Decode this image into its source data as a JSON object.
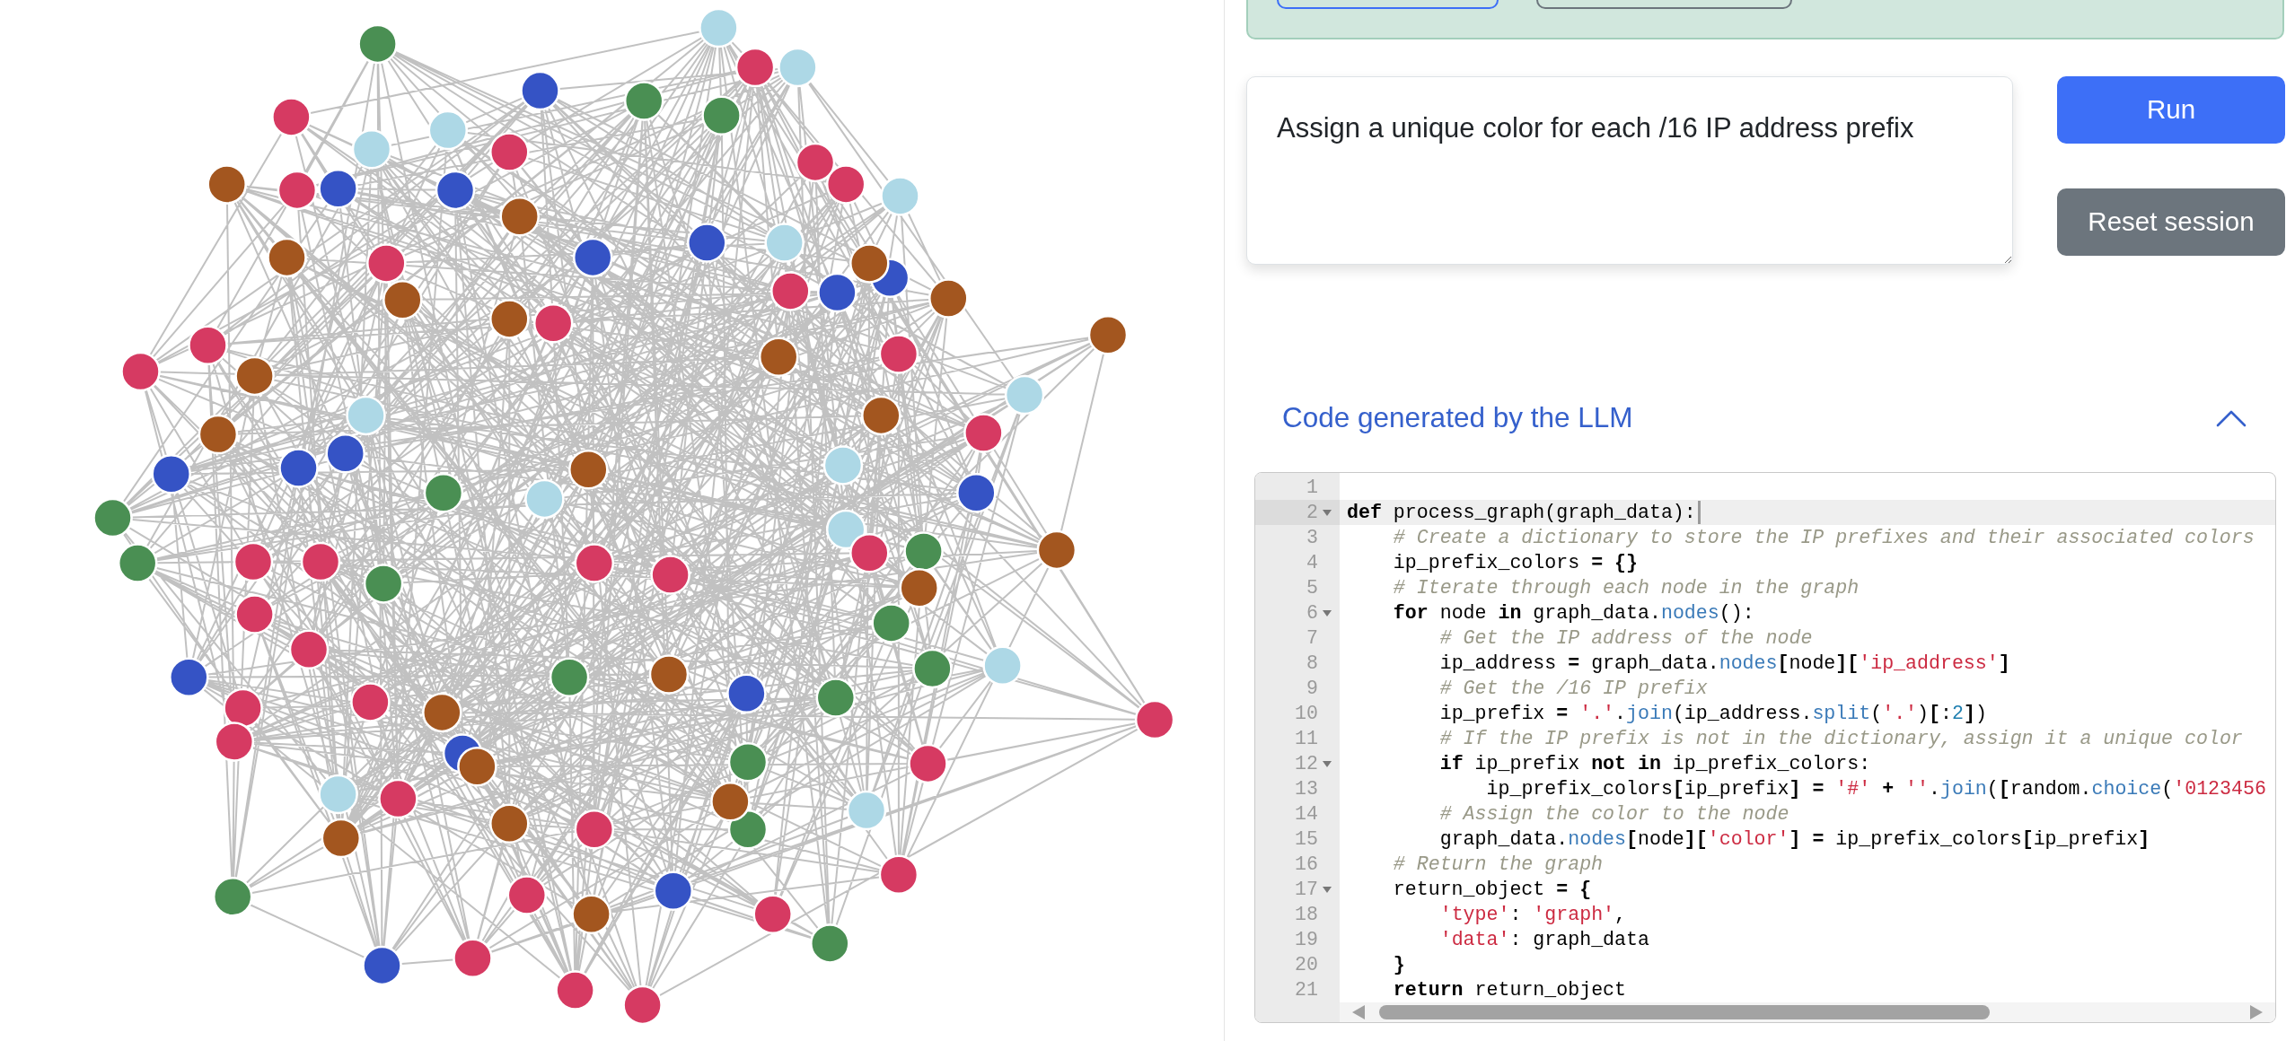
{
  "graph": {
    "nodes": [
      {
        "color": "#4a8f53"
      },
      {
        "color": "#add8e6"
      },
      {
        "color": "#d63a62"
      },
      {
        "color": "#add8e6"
      },
      {
        "color": "#3553c5"
      },
      {
        "color": "#4a8f53"
      },
      {
        "color": "#4a8f53"
      },
      {
        "color": "#d63a62"
      },
      {
        "color": "#add8e6"
      },
      {
        "color": "#add8e6"
      },
      {
        "color": "#d63a62"
      },
      {
        "color": "#d63a62"
      },
      {
        "color": "#d63a62"
      },
      {
        "color": "#add8e6"
      },
      {
        "color": "#a3561f"
      },
      {
        "color": "#d63a62"
      },
      {
        "color": "#3553c5"
      },
      {
        "color": "#3553c5"
      },
      {
        "color": "#a3561f"
      },
      {
        "color": "#add8e6"
      },
      {
        "color": "#3553c5"
      },
      {
        "color": "#3553c5"
      },
      {
        "color": "#a3561f"
      },
      {
        "color": "#d63a62"
      },
      {
        "color": "#3553c5"
      },
      {
        "color": "#a3561f"
      },
      {
        "color": "#3553c5"
      },
      {
        "color": "#d63a62"
      },
      {
        "color": "#a3561f"
      },
      {
        "color": "#a3561f"
      },
      {
        "color": "#a3561f"
      },
      {
        "color": "#d63a62"
      },
      {
        "color": "#a3561f"
      },
      {
        "color": "#d63a62"
      },
      {
        "color": "#a3561f"
      },
      {
        "color": "#d63a62"
      },
      {
        "color": "#d63a62"
      },
      {
        "color": "#a3561f"
      },
      {
        "color": "#add8e6"
      },
      {
        "color": "#a3561f"
      },
      {
        "color": "#add8e6"
      },
      {
        "color": "#a3561f"
      },
      {
        "color": "#d63a62"
      },
      {
        "color": "#3553c5"
      },
      {
        "color": "#3553c5"
      },
      {
        "color": "#3553c5"
      },
      {
        "color": "#add8e6"
      },
      {
        "color": "#a3561f"
      },
      {
        "color": "#4a8f53"
      },
      {
        "color": "#add8e6"
      },
      {
        "color": "#3553c5"
      },
      {
        "color": "#4a8f53"
      },
      {
        "color": "#add8e6"
      },
      {
        "color": "#4a8f53"
      },
      {
        "color": "#d63a62"
      },
      {
        "color": "#d63a62"
      },
      {
        "color": "#d63a62"
      },
      {
        "color": "#d63a62"
      },
      {
        "color": "#d63a62"
      },
      {
        "color": "#4a8f53"
      },
      {
        "color": "#a3561f"
      },
      {
        "color": "#a3561f"
      },
      {
        "color": "#4a8f53"
      },
      {
        "color": "#d63a62"
      },
      {
        "color": "#4a8f53"
      },
      {
        "color": "#d63a62"
      },
      {
        "color": "#add8e6"
      },
      {
        "color": "#4a8f53"
      },
      {
        "color": "#3553c5"
      },
      {
        "color": "#4a8f53"
      },
      {
        "color": "#a3561f"
      },
      {
        "color": "#3553c5"
      },
      {
        "color": "#4a8f53"
      },
      {
        "color": "#d63a62"
      },
      {
        "color": "#d63a62"
      },
      {
        "color": "#a3561f"
      },
      {
        "color": "#d63a62"
      },
      {
        "color": "#d63a62"
      },
      {
        "color": "#3553c5"
      },
      {
        "color": "#a3561f"
      },
      {
        "color": "#4a8f53"
      },
      {
        "color": "#d63a62"
      },
      {
        "color": "#add8e6"
      },
      {
        "color": "#d63a62"
      },
      {
        "color": "#4a8f53"
      },
      {
        "color": "#a3561f"
      },
      {
        "color": "#add8e6"
      },
      {
        "color": "#a3561f"
      },
      {
        "color": "#a3561f"
      },
      {
        "color": "#d63a62"
      },
      {
        "color": "#4a8f53"
      },
      {
        "color": "#d63a62"
      },
      {
        "color": "#3553c5"
      },
      {
        "color": "#d63a62"
      },
      {
        "color": "#d63a62"
      },
      {
        "color": "#a3561f"
      },
      {
        "color": "#4a8f53"
      },
      {
        "color": "#3553c5"
      },
      {
        "color": "#d63a62"
      },
      {
        "color": "#d63a62"
      },
      {
        "color": "#d63a62"
      }
    ]
  },
  "alert": {
    "buttons": [
      {
        "kind": "primary"
      },
      {
        "kind": "secondary"
      }
    ]
  },
  "prompt": {
    "value": "Assign a unique color for each /16 IP address prefix"
  },
  "buttons": [
    {
      "kind": "primary",
      "label": "Run"
    },
    {
      "kind": "secondary",
      "label": "Reset session"
    }
  ],
  "code_panel": {
    "title": "Code generated by the LLM",
    "expanded": true,
    "lines": [
      {
        "number": "1",
        "active": false
      },
      {
        "number": "2",
        "active": true,
        "tokens": [
          {
            "kind": "keyword",
            "text": "def"
          },
          {
            "kind": "plain",
            "text": " process_graph(graph_data):"
          }
        ],
        "children": [
          {
            "number": "3",
            "active": false,
            "tokens": [
              {
                "kind": "comment",
                "text": "# Create a dictionary to store the IP prefixes and their associated colors"
              }
            ]
          },
          {
            "number": "4",
            "active": false,
            "tokens": [
              {
                "kind": "plain",
                "text": "ip_prefix_colors "
              },
              {
                "kind": "operator",
                "text": "= {}"
              }
            ]
          },
          {
            "number": "5",
            "active": false,
            "tokens": [
              {
                "kind": "comment",
                "text": "# Iterate through each node in the graph"
              }
            ]
          },
          {
            "number": "6",
            "active": false,
            "tokens": [
              {
                "kind": "keyword",
                "text": "for"
              },
              {
                "kind": "plain",
                "text": " node "
              },
              {
                "kind": "keyword",
                "text": "in"
              },
              {
                "kind": "plain",
                "text": " graph_data."
              },
              {
                "kind": "function",
                "text": "nodes"
              },
              {
                "kind": "plain",
                "text": "():"
              }
            ],
            "children": [
              {
                "number": "7",
                "active": false,
                "tokens": [
                  {
                    "kind": "comment",
                    "text": "# Get the IP address of the node"
                  }
                ]
              },
              {
                "number": "8",
                "active": false,
                "tokens": [
                  {
                    "kind": "plain",
                    "text": "ip_address "
                  },
                  {
                    "kind": "operator",
                    "text": "="
                  },
                  {
                    "kind": "plain",
                    "text": " graph_data."
                  },
                  {
                    "kind": "function",
                    "text": "nodes"
                  },
                  {
                    "kind": "operator",
                    "text": "["
                  },
                  {
                    "kind": "plain",
                    "text": "node"
                  },
                  {
                    "kind": "operator",
                    "text": "]["
                  },
                  {
                    "kind": "string",
                    "text": "'ip_address'"
                  },
                  {
                    "kind": "operator",
                    "text": "]"
                  }
                ]
              },
              {
                "number": "9",
                "active": false,
                "tokens": [
                  {
                    "kind": "comment",
                    "text": "# Get the /16 IP prefix"
                  }
                ]
              },
              {
                "number": "10",
                "active": false,
                "tokens": [
                  {
                    "kind": "plain",
                    "text": "ip_prefix "
                  },
                  {
                    "kind": "operator",
                    "text": "= "
                  },
                  {
                    "kind": "string",
                    "text": "'.'"
                  },
                  {
                    "kind": "plain",
                    "text": "."
                  },
                  {
                    "kind": "function",
                    "text": "join"
                  },
                  {
                    "kind": "plain",
                    "text": "(ip_address."
                  },
                  {
                    "kind": "function",
                    "text": "split"
                  },
                  {
                    "kind": "plain",
                    "text": "("
                  },
                  {
                    "kind": "string",
                    "text": "'.'"
                  },
                  {
                    "kind": "plain",
                    "text": ")"
                  },
                  {
                    "kind": "operator",
                    "text": "["
                  },
                  {
                    "kind": "plain",
                    "text": ":"
                  },
                  {
                    "kind": "number",
                    "text": "2"
                  },
                  {
                    "kind": "operator",
                    "text": "]"
                  },
                  {
                    "kind": "plain",
                    "text": ")"
                  }
                ]
              },
              {
                "number": "11",
                "active": false,
                "tokens": [
                  {
                    "kind": "comment",
                    "text": "# If the IP prefix is not in the dictionary, assign it a unique color"
                  }
                ]
              },
              {
                "number": "12",
                "active": false,
                "tokens": [
                  {
                    "kind": "keyword",
                    "text": "if"
                  },
                  {
                    "kind": "plain",
                    "text": " ip_prefix "
                  },
                  {
                    "kind": "keyword",
                    "text": "not in"
                  },
                  {
                    "kind": "plain",
                    "text": " ip_prefix_colors:"
                  }
                ],
                "children": [
                  {
                    "number": "13",
                    "active": false,
                    "tokens": [
                      {
                        "kind": "plain",
                        "text": "ip_prefix_colors"
                      },
                      {
                        "kind": "operator",
                        "text": "["
                      },
                      {
                        "kind": "plain",
                        "text": "ip_prefix"
                      },
                      {
                        "kind": "operator",
                        "text": "] = "
                      },
                      {
                        "kind": "string",
                        "text": "'#'"
                      },
                      {
                        "kind": "operator",
                        "text": " + "
                      },
                      {
                        "kind": "string",
                        "text": "''"
                      },
                      {
                        "kind": "plain",
                        "text": "."
                      },
                      {
                        "kind": "function",
                        "text": "join"
                      },
                      {
                        "kind": "plain",
                        "text": "("
                      },
                      {
                        "kind": "operator",
                        "text": "["
                      },
                      {
                        "kind": "plain",
                        "text": "random."
                      },
                      {
                        "kind": "function",
                        "text": "choice"
                      },
                      {
                        "kind": "plain",
                        "text": "("
                      },
                      {
                        "kind": "string",
                        "text": "'0123456"
                      }
                    ]
                  }
                ]
              },
              {
                "number": "14",
                "active": false,
                "tokens": [
                  {
                    "kind": "comment",
                    "text": "# Assign the color to the node"
                  }
                ]
              },
              {
                "number": "15",
                "active": false,
                "tokens": [
                  {
                    "kind": "plain",
                    "text": "graph_data."
                  },
                  {
                    "kind": "function",
                    "text": "nodes"
                  },
                  {
                    "kind": "operator",
                    "text": "["
                  },
                  {
                    "kind": "plain",
                    "text": "node"
                  },
                  {
                    "kind": "operator",
                    "text": "]["
                  },
                  {
                    "kind": "string",
                    "text": "'color'"
                  },
                  {
                    "kind": "operator",
                    "text": "] = "
                  },
                  {
                    "kind": "plain",
                    "text": "ip_prefix_colors"
                  },
                  {
                    "kind": "operator",
                    "text": "["
                  },
                  {
                    "kind": "plain",
                    "text": "ip_prefix"
                  },
                  {
                    "kind": "operator",
                    "text": "]"
                  }
                ]
              }
            ]
          },
          {
            "number": "16",
            "active": false,
            "tokens": [
              {
                "kind": "comment",
                "text": "# Return the graph"
              }
            ]
          },
          {
            "number": "17",
            "active": false,
            "tokens": [
              {
                "kind": "plain",
                "text": "return_object "
              },
              {
                "kind": "operator",
                "text": "= {"
              }
            ],
            "children": [
              {
                "number": "18",
                "active": false,
                "tokens": [
                  {
                    "kind": "string",
                    "text": "'type'"
                  },
                  {
                    "kind": "plain",
                    "text": ": "
                  },
                  {
                    "kind": "string",
                    "text": "'graph'"
                  },
                  {
                    "kind": "plain",
                    "text": ","
                  }
                ]
              },
              {
                "number": "19",
                "active": false,
                "tokens": [
                  {
                    "kind": "string",
                    "text": "'data'"
                  },
                  {
                    "kind": "plain",
                    "text": ": graph_data"
                  }
                ]
              }
            ]
          },
          {
            "number": "20",
            "active": false,
            "tokens": [
              {
                "kind": "operator",
                "text": "}"
              }
            ]
          },
          {
            "number": "21",
            "active": false,
            "tokens": [
              {
                "kind": "keyword",
                "text": "return"
              },
              {
                "kind": "plain",
                "text": " return_object"
              }
            ]
          }
        ]
      }
    ]
  }
}
